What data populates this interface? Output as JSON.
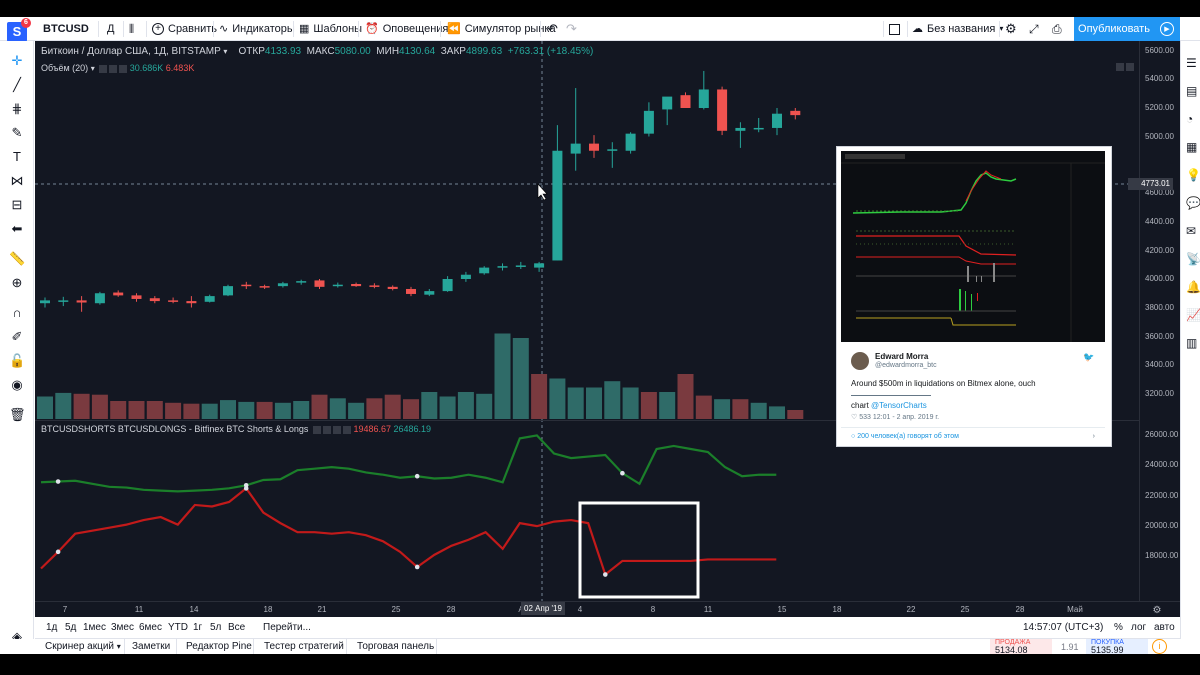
{
  "toolbar": {
    "logo": "S",
    "logo_badge": "6",
    "symbol": "BTCUSD",
    "interval": "Д",
    "compare": "Сравнить",
    "indicators": "Индикаторы",
    "templates": "Шаблоны",
    "alerts": "Оповещения",
    "replay": "Симулятор рынка",
    "layout_name": "Без названия",
    "publish": "Опубликовать"
  },
  "legend": {
    "symbol_title": "Биткоин / Доллар США, 1Д, BITSTAMP",
    "open_label": "ОТКР",
    "open_value": "4133.93",
    "high_label": "МАКС",
    "high_value": "5080.00",
    "low_label": "МИН",
    "low_value": "4130.64",
    "close_label": "ЗАКР",
    "close_value": "4899.63",
    "change": "+763.31 (+18.45%)",
    "volume_label": "Объём (20)",
    "volume_value_1": "30.686K",
    "volume_value_2": "6.483K",
    "indicator_title": "BTCUSDSHORTS BTCUSDLONGS - Bitfinex BTC Shorts & Longs",
    "shorts_value": "19486.67",
    "longs_value": "26486.19"
  },
  "price_axis": [
    "5600.00",
    "5400.00",
    "5200.00",
    "5000.00",
    "4600.00",
    "4400.00",
    "4200.00",
    "4000.00",
    "3800.00",
    "3600.00",
    "3400.00",
    "3200.00"
  ],
  "price_marker": "4773.01",
  "ind_axis": [
    "26000.00",
    "24000.00",
    "22000.00",
    "20000.00",
    "18000.00"
  ],
  "time_axis": [
    "7",
    "11",
    "14",
    "18",
    "21",
    "25",
    "28",
    "A",
    "4",
    "8",
    "11",
    "15",
    "18",
    "22",
    "25",
    "28",
    "Май"
  ],
  "crosshair_date": "02 Апр '19",
  "tweet": {
    "name": "Edward Morra",
    "handle": "@edwardmorra_btc",
    "text": "Around $500m in liquidations on Bitmex alone, ouch",
    "chart_prefix": "chart ",
    "chart_link": "@TensorCharts",
    "meta": "533   12:01 - 2 апр. 2019 г.",
    "conversation": "200 человек(а) говорят об этом"
  },
  "ranges": [
    "1д",
    "5д",
    "1мес",
    "3мес",
    "6мес",
    "YTD",
    "1г",
    "5л",
    "Все",
    "Перейти..."
  ],
  "status": {
    "clock": "14:57:07 (UTC+3)",
    "percent": "%",
    "log": "лог",
    "auto": "авто"
  },
  "bottom_panel": [
    "Скринер акций",
    "Заметки",
    "Редактор Pine",
    "Тестер стратегий",
    "Торговая панель"
  ],
  "trade": {
    "sell_label": "ПРОДАЖА",
    "sell_value": "5134.08",
    "spread": "1.91",
    "buy_label": "ПОКУПКА",
    "buy_value": "5135.99"
  },
  "colors": {
    "up": "#26a69a",
    "down": "#ef5350",
    "longs": "#1b7f2a",
    "shorts": "#c21a1a",
    "bg": "#131722",
    "accent": "#2196f3"
  },
  "candles": [
    {
      "o": 3830,
      "h": 3870,
      "l": 3800,
      "c": 3850
    },
    {
      "o": 3845,
      "h": 3875,
      "l": 3810,
      "c": 3850
    },
    {
      "o": 3850,
      "h": 3880,
      "l": 3770,
      "c": 3835
    },
    {
      "o": 3830,
      "h": 3910,
      "l": 3820,
      "c": 3900
    },
    {
      "o": 3905,
      "h": 3920,
      "l": 3875,
      "c": 3885
    },
    {
      "o": 3885,
      "h": 3900,
      "l": 3840,
      "c": 3860
    },
    {
      "o": 3865,
      "h": 3880,
      "l": 3830,
      "c": 3845
    },
    {
      "o": 3850,
      "h": 3870,
      "l": 3830,
      "c": 3840
    },
    {
      "o": 3845,
      "h": 3880,
      "l": 3800,
      "c": 3830
    },
    {
      "o": 3840,
      "h": 3890,
      "l": 3835,
      "c": 3880
    },
    {
      "o": 3885,
      "h": 3960,
      "l": 3880,
      "c": 3950
    },
    {
      "o": 3960,
      "h": 3980,
      "l": 3930,
      "c": 3955
    },
    {
      "o": 3950,
      "h": 3960,
      "l": 3930,
      "c": 3945
    },
    {
      "o": 3950,
      "h": 3980,
      "l": 3940,
      "c": 3970
    },
    {
      "o": 3975,
      "h": 3995,
      "l": 3960,
      "c": 3985
    },
    {
      "o": 3990,
      "h": 4000,
      "l": 3930,
      "c": 3945
    },
    {
      "o": 3950,
      "h": 3975,
      "l": 3940,
      "c": 3960
    },
    {
      "o": 3965,
      "h": 3975,
      "l": 3945,
      "c": 3950
    },
    {
      "o": 3955,
      "h": 3970,
      "l": 3935,
      "c": 3945
    },
    {
      "o": 3945,
      "h": 3955,
      "l": 3920,
      "c": 3930
    },
    {
      "o": 3930,
      "h": 3945,
      "l": 3880,
      "c": 3895
    },
    {
      "o": 3890,
      "h": 3930,
      "l": 3880,
      "c": 3915
    },
    {
      "o": 3915,
      "h": 4020,
      "l": 3910,
      "c": 4000
    },
    {
      "o": 4000,
      "h": 4050,
      "l": 3980,
      "c": 4030
    },
    {
      "o": 4040,
      "h": 4090,
      "l": 4030,
      "c": 4080
    },
    {
      "o": 4085,
      "h": 4110,
      "l": 4060,
      "c": 4090
    },
    {
      "o": 4090,
      "h": 4120,
      "l": 4070,
      "c": 4095
    },
    {
      "o": 4080,
      "h": 4120,
      "l": 4050,
      "c": 4110
    },
    {
      "o": 4130,
      "h": 5080,
      "l": 4130,
      "c": 4900
    },
    {
      "o": 4880,
      "h": 5340,
      "l": 4760,
      "c": 4950
    },
    {
      "o": 4950,
      "h": 5010,
      "l": 4850,
      "c": 4900
    },
    {
      "o": 4900,
      "h": 4960,
      "l": 4780,
      "c": 4910
    },
    {
      "o": 4900,
      "h": 5030,
      "l": 4880,
      "c": 5020
    },
    {
      "o": 5020,
      "h": 5240,
      "l": 5000,
      "c": 5180
    },
    {
      "o": 5190,
      "h": 5260,
      "l": 5080,
      "c": 5280
    },
    {
      "o": 5290,
      "h": 5310,
      "l": 5220,
      "c": 5200
    },
    {
      "o": 5200,
      "h": 5460,
      "l": 5190,
      "c": 5330
    },
    {
      "o": 5330,
      "h": 5350,
      "l": 5010,
      "c": 5040
    },
    {
      "o": 5040,
      "h": 5100,
      "l": 4920,
      "c": 5060
    },
    {
      "o": 5055,
      "h": 5130,
      "l": 5030,
      "c": 5060
    },
    {
      "o": 5060,
      "h": 5200,
      "l": 5010,
      "c": 5160
    },
    {
      "o": 5180,
      "h": 5200,
      "l": 5120,
      "c": 5150
    }
  ],
  "volumes": [
    {
      "v": 0.25,
      "d": 0
    },
    {
      "v": 0.29,
      "d": 0
    },
    {
      "v": 0.28,
      "d": 1
    },
    {
      "v": 0.27,
      "d": 1
    },
    {
      "v": 0.2,
      "d": 1
    },
    {
      "v": 0.2,
      "d": 1
    },
    {
      "v": 0.2,
      "d": 1
    },
    {
      "v": 0.18,
      "d": 1
    },
    {
      "v": 0.17,
      "d": 1
    },
    {
      "v": 0.17,
      "d": 0
    },
    {
      "v": 0.21,
      "d": 0
    },
    {
      "v": 0.19,
      "d": 0
    },
    {
      "v": 0.19,
      "d": 1
    },
    {
      "v": 0.18,
      "d": 0
    },
    {
      "v": 0.2,
      "d": 0
    },
    {
      "v": 0.27,
      "d": 1
    },
    {
      "v": 0.23,
      "d": 0
    },
    {
      "v": 0.18,
      "d": 0
    },
    {
      "v": 0.23,
      "d": 1
    },
    {
      "v": 0.27,
      "d": 1
    },
    {
      "v": 0.22,
      "d": 1
    },
    {
      "v": 0.3,
      "d": 0
    },
    {
      "v": 0.25,
      "d": 0
    },
    {
      "v": 0.3,
      "d": 0
    },
    {
      "v": 0.28,
      "d": 0
    },
    {
      "v": 0.95,
      "d": 0
    },
    {
      "v": 0.9,
      "d": 0
    },
    {
      "v": 0.5,
      "d": 1
    },
    {
      "v": 0.45,
      "d": 0
    },
    {
      "v": 0.35,
      "d": 0
    },
    {
      "v": 0.35,
      "d": 0
    },
    {
      "v": 0.42,
      "d": 0
    },
    {
      "v": 0.35,
      "d": 0
    },
    {
      "v": 0.3,
      "d": 1
    },
    {
      "v": 0.3,
      "d": 0
    },
    {
      "v": 0.5,
      "d": 1
    },
    {
      "v": 0.26,
      "d": 1
    },
    {
      "v": 0.22,
      "d": 0
    },
    {
      "v": 0.22,
      "d": 1
    },
    {
      "v": 0.18,
      "d": 0
    },
    {
      "v": 0.14,
      "d": 0
    },
    {
      "v": 0.1,
      "d": 1
    }
  ],
  "longs": [
    23800,
    23850,
    23900,
    23700,
    23500,
    23450,
    23300,
    23250,
    23200,
    23250,
    23300,
    23400,
    23600,
    23950,
    24000,
    24600,
    24700,
    24800,
    24700,
    24450,
    24300,
    24100,
    24200,
    24050,
    24100,
    24300,
    24100,
    23800,
    26700,
    26900,
    25700,
    25400,
    25500,
    25600,
    24400,
    23700,
    26000,
    26200,
    26000,
    25800,
    24800,
    24200,
    24300,
    24300
  ],
  "shorts": [
    18100,
    19200,
    20400,
    20600,
    20800,
    21000,
    21300,
    21500,
    21000,
    22300,
    22200,
    22500,
    23400,
    21800,
    21100,
    20500,
    20500,
    20400,
    20500,
    20300,
    19900,
    19200,
    18200,
    19000,
    19600,
    20000,
    20500,
    19400,
    21100,
    20900,
    21200,
    21300,
    21100,
    17700,
    18600,
    18600,
    18600,
    18600,
    18600,
    18700,
    18700,
    18700,
    18700,
    18700
  ]
}
